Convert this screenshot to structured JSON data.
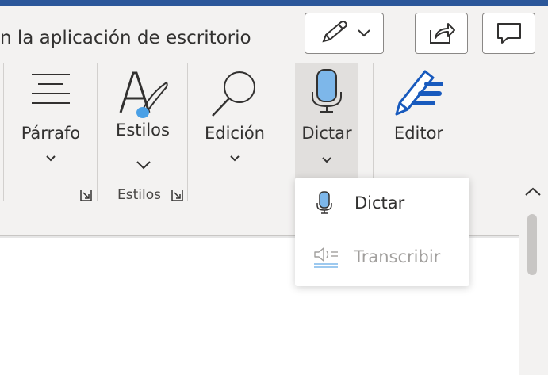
{
  "header": {
    "title": "n la aplicación de escritorio"
  },
  "ribbon": {
    "parrafo_label": "Párrafo",
    "estilos_label": "Estilos",
    "estilos_group_label": "Estilos",
    "edicion_label": "Edición",
    "dictar_label": "Dictar",
    "editor_label": "Editor"
  },
  "dictate_menu": {
    "dictar_label": "Dictar",
    "transcribir_label": "Transcribir"
  },
  "colors": {
    "brand": "#2b579a",
    "accent_blue": "#185abd",
    "disabled_text": "#a19f9d"
  }
}
